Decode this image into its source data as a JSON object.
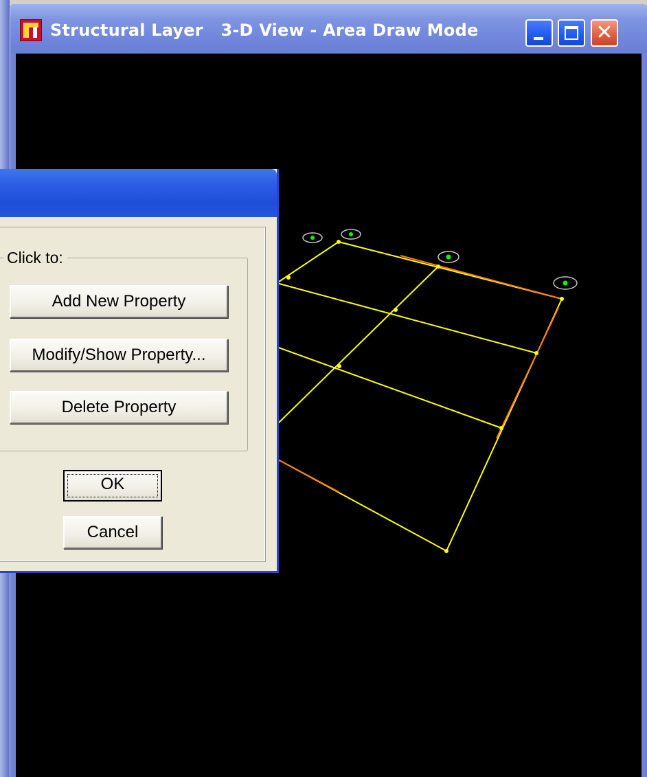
{
  "window": {
    "title": "Structural Layer   3-D View - Area Draw Mode",
    "app_icon": "app-logo-icon",
    "controls": {
      "minimize_icon": "minimize-icon",
      "maximize_icon": "maximize-icon",
      "close_icon": "close-icon",
      "close_glyph": "✕"
    }
  },
  "dialog": {
    "group_label": "Click to:",
    "buttons": {
      "add": "Add New Property",
      "modify": "Modify/Show Property...",
      "delete": "Delete Property",
      "ok": "OK",
      "cancel": "Cancel"
    }
  },
  "colors": {
    "grid_line": "#ffff00",
    "grid_edge": "#ff8c00",
    "support_marker": "#00ff00",
    "viewport_bg": "#000000",
    "titlebar_accent": "#2a5ce6"
  }
}
